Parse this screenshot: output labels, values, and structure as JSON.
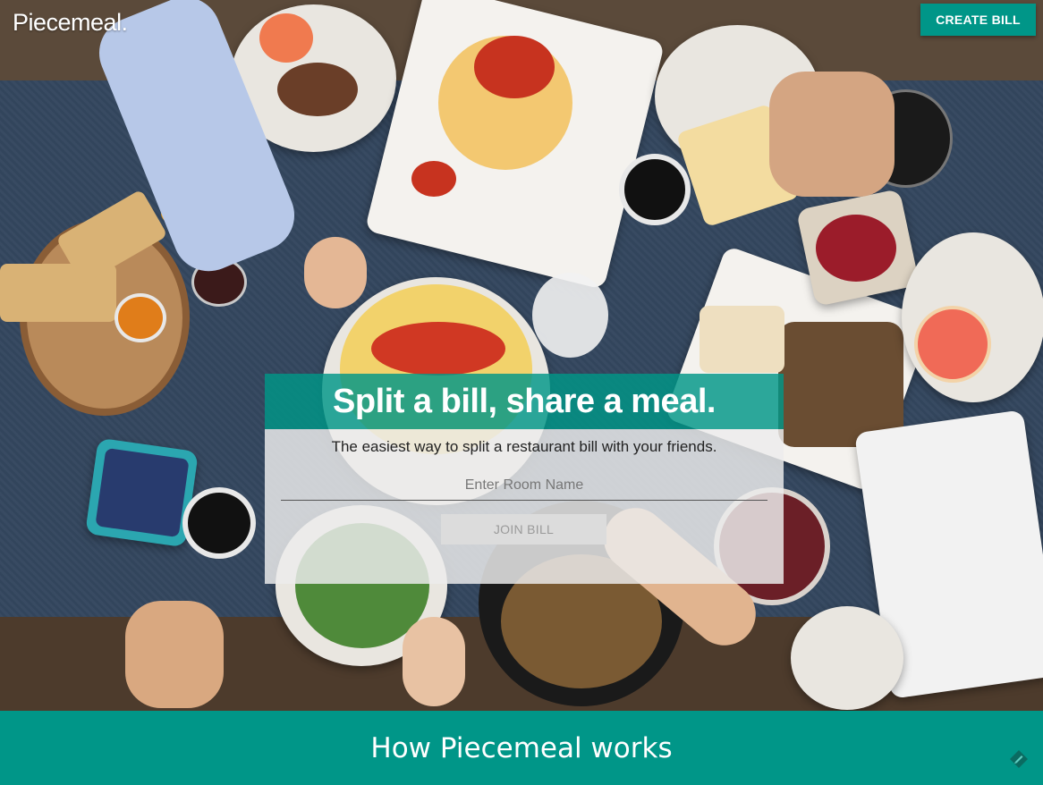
{
  "header": {
    "logo": "Piecemeal.",
    "create_bill_label": "CREATE BILL"
  },
  "hero": {
    "headline": "Split a bill, share a meal.",
    "subtitle": "The easiest way to split a restaurant bill with your friends.",
    "room_input_placeholder": "Enter Room Name",
    "room_input_value": "",
    "join_bill_label": "JOIN BILL"
  },
  "how_section": {
    "title": "How Piecemeal works"
  },
  "colors": {
    "accent": "#009688",
    "card_bg": "#ececec"
  },
  "icons": {
    "corner": "edit-pencil-icon"
  }
}
